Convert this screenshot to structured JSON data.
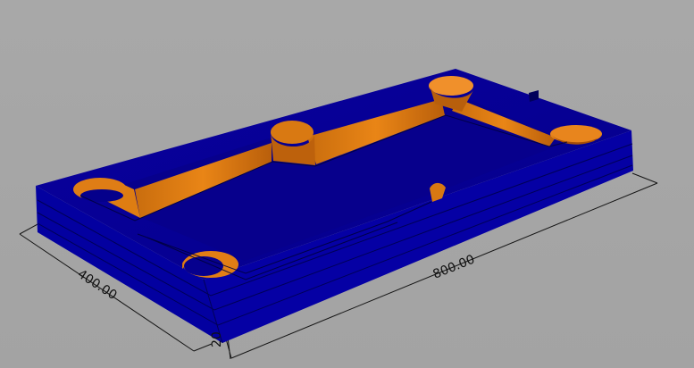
{
  "dimensions": {
    "width": "400.00",
    "length": "800.00",
    "height": "20"
  },
  "colors": {
    "background": "#a5a5a5",
    "body": "#05008f",
    "body_dark": "#020060",
    "pocket_wall": "#d77a14",
    "pocket_wall_light": "#f09a2a",
    "dimension_line": "#151515"
  },
  "icons": {
    "pocket": "rounded-cutout",
    "hole": "circular-cutout"
  }
}
